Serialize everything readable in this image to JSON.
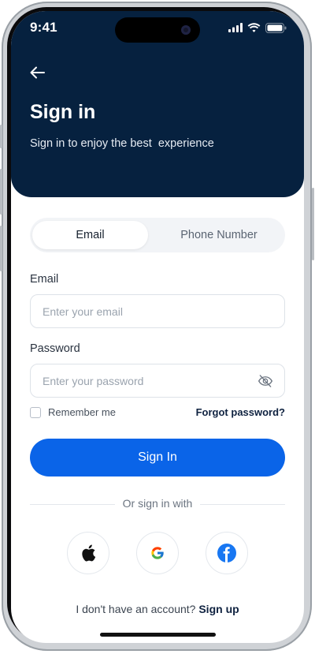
{
  "status_bar": {
    "time": "9:41"
  },
  "header": {
    "title": "Sign in",
    "subtitle": "Sign in to enjoy the best  experience"
  },
  "tabs": [
    {
      "label": "Email",
      "selected": true
    },
    {
      "label": "Phone Number",
      "selected": false
    }
  ],
  "form": {
    "email": {
      "label": "Email",
      "placeholder": "Enter your email",
      "value": ""
    },
    "password": {
      "label": "Password",
      "placeholder": "Enter your password",
      "value": ""
    },
    "remember_label": "Remember me",
    "remember_checked": false,
    "forgot_label": "Forgot password?",
    "submit_label": "Sign In"
  },
  "social": {
    "divider_text": "Or sign in with",
    "providers": [
      "apple-icon",
      "google-icon",
      "facebook-icon"
    ]
  },
  "footer": {
    "prompt": "I don't have an account?",
    "link": "Sign up"
  },
  "colors": {
    "header_bg": "#06213f",
    "primary": "#0a64e8",
    "facebook": "#1877f2"
  }
}
